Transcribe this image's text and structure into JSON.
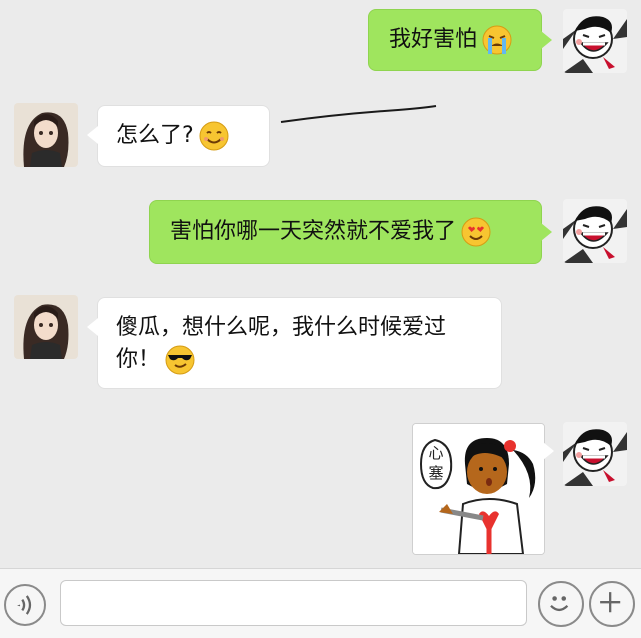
{
  "messages": [
    {
      "side": "right",
      "text": "我好害怕",
      "emoji": "crying-face-icon"
    },
    {
      "side": "left",
      "text": "怎么了?",
      "emoji": "smiling-face-icon"
    },
    {
      "side": "right",
      "text": "害怕你哪一天突然就不爱我了",
      "emoji": "heart-eyes-face-icon"
    },
    {
      "side": "left",
      "text_line1": "傻瓜，想什么呢，我什么时候爱过",
      "text_line2": "你！",
      "emoji": "sunglasses-face-icon"
    },
    {
      "side": "right",
      "sticker": "girl-stabbed-heart-sticker",
      "sticker_text": "心塞"
    }
  ],
  "avatars": {
    "me": "cartoon-laughing-face-avatar",
    "other": "anime-girl-avatar"
  },
  "input_bar": {
    "voice_icon": "voice-icon",
    "emoji_icon": "emoji-icon",
    "plus_icon": "plus-icon",
    "input_value": ""
  },
  "colors": {
    "my_bubble": "#9fe55e",
    "other_bubble": "#ffffff",
    "background": "#ebebeb"
  }
}
